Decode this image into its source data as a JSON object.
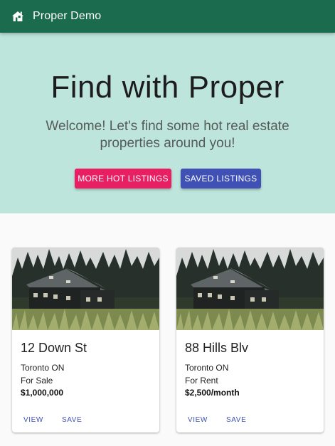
{
  "appbar": {
    "icon": "home-icon",
    "title": "Proper Demo",
    "color": "#1b6b4e"
  },
  "hero": {
    "heading": "Find with Proper",
    "subheading": "Welcome! Let's find some hot real estate properties around you!",
    "background": "#bde5db",
    "buttons": {
      "more_hot": "MORE HOT LISTINGS",
      "saved": "SAVED LISTINGS"
    },
    "button_colors": {
      "more_hot": "#e91f63",
      "saved": "#3f51b5"
    }
  },
  "listings": [
    {
      "address": "12 Down St",
      "city": "Toronto ON",
      "status": "For Sale",
      "price": "$1,000,000",
      "actions": {
        "view": "VIEW",
        "save": "SAVE"
      }
    },
    {
      "address": "88 Hills Blv",
      "city": "Toronto ON",
      "status": "For Rent",
      "price": "$2,500/month",
      "actions": {
        "view": "VIEW",
        "save": "SAVE"
      }
    }
  ]
}
